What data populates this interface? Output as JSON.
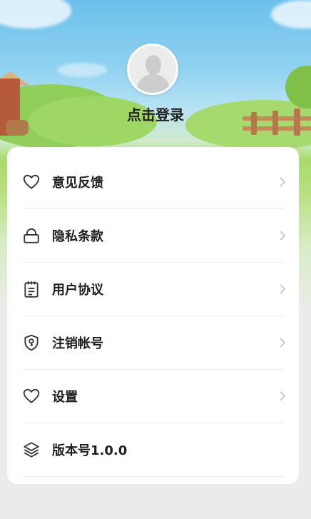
{
  "profile": {
    "login_label": "点击登录"
  },
  "menu": {
    "items": [
      {
        "label": "意见反馈",
        "icon": "heart-icon",
        "chevron": true
      },
      {
        "label": "隐私条款",
        "icon": "lock-icon",
        "chevron": true
      },
      {
        "label": "用户协议",
        "icon": "clipboard-icon",
        "chevron": true
      },
      {
        "label": "注销帐号",
        "icon": "shield-key-icon",
        "chevron": true
      },
      {
        "label": "设置",
        "icon": "heart-icon",
        "chevron": true
      },
      {
        "label": "版本号1.0.0",
        "icon": "layers-icon",
        "chevron": false
      }
    ]
  },
  "colors": {
    "sky": "#6cc0ea",
    "grass": "#a9dc6a",
    "card": "#ffffff",
    "text": "#1f1f1f",
    "icon": "#333333",
    "chevron": "#c2c2c2",
    "page_bg": "#e9ece8"
  }
}
